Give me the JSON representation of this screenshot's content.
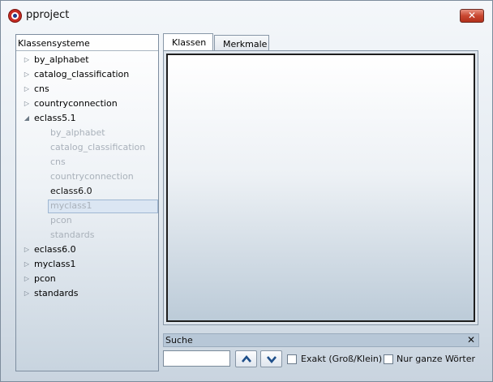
{
  "window": {
    "title": "pproject"
  },
  "titlebar": {
    "close_glyph": "✕",
    "icon": "app-logo-icon"
  },
  "tree": {
    "header": "Klassensysteme",
    "items": [
      {
        "label": "by_alphabet",
        "arrow": "▷",
        "level": 0,
        "state": "normal"
      },
      {
        "label": "catalog_classification",
        "arrow": "▷",
        "level": 0,
        "state": "normal"
      },
      {
        "label": "cns",
        "arrow": "▷",
        "level": 0,
        "state": "normal"
      },
      {
        "label": "countryconnection",
        "arrow": "▷",
        "level": 0,
        "state": "normal"
      },
      {
        "label": "eclass5.1",
        "arrow": "◢",
        "level": 0,
        "state": "expanded"
      },
      {
        "label": "by_alphabet",
        "arrow": "",
        "level": 1,
        "state": "dim"
      },
      {
        "label": "catalog_classification",
        "arrow": "",
        "level": 1,
        "state": "dim"
      },
      {
        "label": "cns",
        "arrow": "",
        "level": 1,
        "state": "dim"
      },
      {
        "label": "countryconnection",
        "arrow": "",
        "level": 1,
        "state": "dim"
      },
      {
        "label": "eclass6.0",
        "arrow": "",
        "level": 1,
        "state": "dark"
      },
      {
        "label": "myclass1",
        "arrow": "",
        "level": 1,
        "state": "selected"
      },
      {
        "label": "pcon",
        "arrow": "",
        "level": 1,
        "state": "dim"
      },
      {
        "label": "standards",
        "arrow": "",
        "level": 1,
        "state": "dim"
      },
      {
        "label": "eclass6.0",
        "arrow": "▷",
        "level": 0,
        "state": "normal"
      },
      {
        "label": "myclass1",
        "arrow": "▷",
        "level": 0,
        "state": "normal"
      },
      {
        "label": "pcon",
        "arrow": "▷",
        "level": 0,
        "state": "normal"
      },
      {
        "label": "standards",
        "arrow": "▷",
        "level": 0,
        "state": "normal"
      }
    ]
  },
  "tabs": [
    {
      "label": "Klassen",
      "active": true
    },
    {
      "label": "Merkmale",
      "active": false
    }
  ],
  "search": {
    "title": "Suche",
    "close_glyph": "✕",
    "input_value": "",
    "up_icon": "chevron-up-icon",
    "down_icon": "chevron-down-icon",
    "exact_label": "Exakt (Groß/Klein)",
    "whole_words_label": "Nur ganze Wörter"
  }
}
